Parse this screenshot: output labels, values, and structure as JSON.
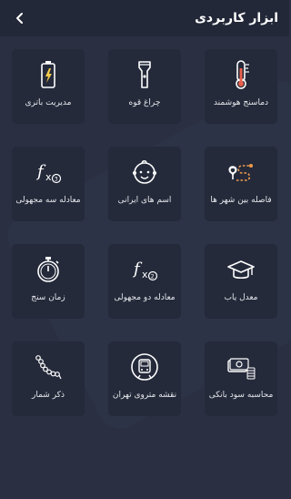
{
  "header": {
    "title": "ابزار کاربردی"
  },
  "tiles": [
    {
      "label": "دماسنج هوشمند",
      "icon": "thermometer-icon"
    },
    {
      "label": "چراغ قوه",
      "icon": "flashlight-icon"
    },
    {
      "label": "مدیریت باتری",
      "icon": "battery-icon"
    },
    {
      "label": "فاصله بین شهر ها",
      "icon": "route-pin-icon"
    },
    {
      "label": "اسم های ایرانی",
      "icon": "baby-face-icon"
    },
    {
      "label": "معادله سه مجهولی",
      "icon": "function-x3-icon"
    },
    {
      "label": "معدل یاب",
      "icon": "graduation-cap-icon"
    },
    {
      "label": "معادله دو مجهولی",
      "icon": "function-x2-icon"
    },
    {
      "label": "زمان سنج",
      "icon": "stopwatch-icon"
    },
    {
      "label": "محاسبه سود بانکی",
      "icon": "money-coins-icon"
    },
    {
      "label": "نقشه متروی تهران",
      "icon": "metro-train-icon"
    },
    {
      "label": "ذکر شمار",
      "icon": "prayer-beads-icon"
    }
  ],
  "colors": {
    "background": "#2a3042",
    "header": "#222838",
    "tile": "#242a3a",
    "text": "#e6e7ec"
  }
}
